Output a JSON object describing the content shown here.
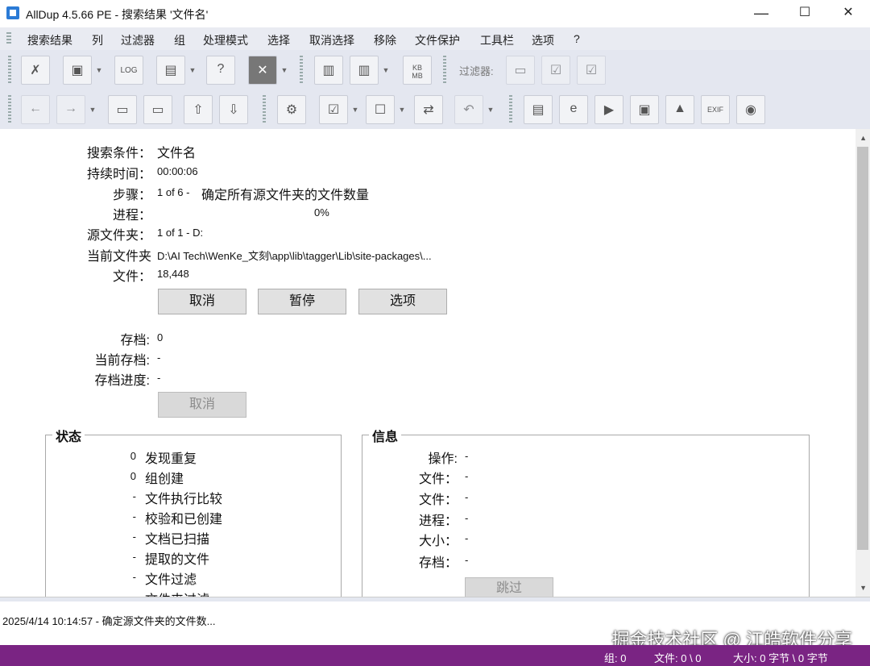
{
  "window": {
    "title": "AllDup 4.5.66 PE - 搜索结果 '文件名'",
    "minimize": "—",
    "maximize": "☐",
    "close": "✕"
  },
  "menu": [
    "搜索结果",
    "列",
    "过滤器",
    "组",
    "处理模式",
    "选择",
    "取消选择",
    "移除",
    "文件保护",
    "工具栏",
    "选项",
    "?"
  ],
  "toolbar": {
    "filter_label": "过滤器:"
  },
  "search": {
    "criteria_label": "搜索条件：",
    "criteria_value": "文件名",
    "duration_label": "持续时间：",
    "duration_value": "00:00:06",
    "step_label": "步骤：",
    "step_value": "1 of 6 - ",
    "step_desc": "确定所有源文件夹的文件数量",
    "progress_label": "进程：",
    "progress_value": "0%",
    "source_label": "源文件夹：",
    "source_value": "1 of 1 - D:",
    "current_label": "当前文件夹",
    "current_value": "D:\\AI Tech\\WenKe_文刻\\app\\lib\\tagger\\Lib\\site-packages\\...",
    "files_label": "文件：",
    "files_value": "18,448",
    "btn_cancel": "取消",
    "btn_pause": "暂停",
    "btn_options": "选项"
  },
  "archive": {
    "archive_label": "存档:",
    "archive_value": "0",
    "current_label": "当前存档:",
    "current_value": "-",
    "progress_label": "存档进度:",
    "progress_value": "-",
    "btn_cancel": "取消"
  },
  "status_group": {
    "title": "状态",
    "rows": [
      {
        "num": "0",
        "text": "发现重复"
      },
      {
        "num": "0",
        "text": "组创建"
      },
      {
        "num": "-",
        "text": "文件执行比较"
      },
      {
        "num": "-",
        "text": "校验和已创建"
      },
      {
        "num": "-",
        "text": "文档已扫描"
      },
      {
        "num": "-",
        "text": "提取的文件"
      },
      {
        "num": "-",
        "text": "文件过滤"
      },
      {
        "num": "",
        "text": "文件夹过滤"
      }
    ]
  },
  "info_group": {
    "title": "信息",
    "rows": [
      {
        "label": "操作:",
        "value": "-"
      },
      {
        "label": "文件：",
        "value": "-"
      },
      {
        "label": "文件：",
        "value": "-"
      },
      {
        "label": "进程：",
        "value": "-"
      },
      {
        "label": "大小：",
        "value": "-"
      },
      {
        "label": "存档：",
        "value": "-"
      }
    ],
    "btn_skip": "跳过"
  },
  "log": {
    "line": "2025/4/14 10:14:57 - 确定源文件夹的文件数..."
  },
  "watermark": "掘金技术社区 @ 江皓软件分享",
  "statusbar": {
    "groups": "组: 0",
    "files": "文件: 0 \\ 0",
    "size": "大小: 0 字节 \\ 0 字节"
  }
}
